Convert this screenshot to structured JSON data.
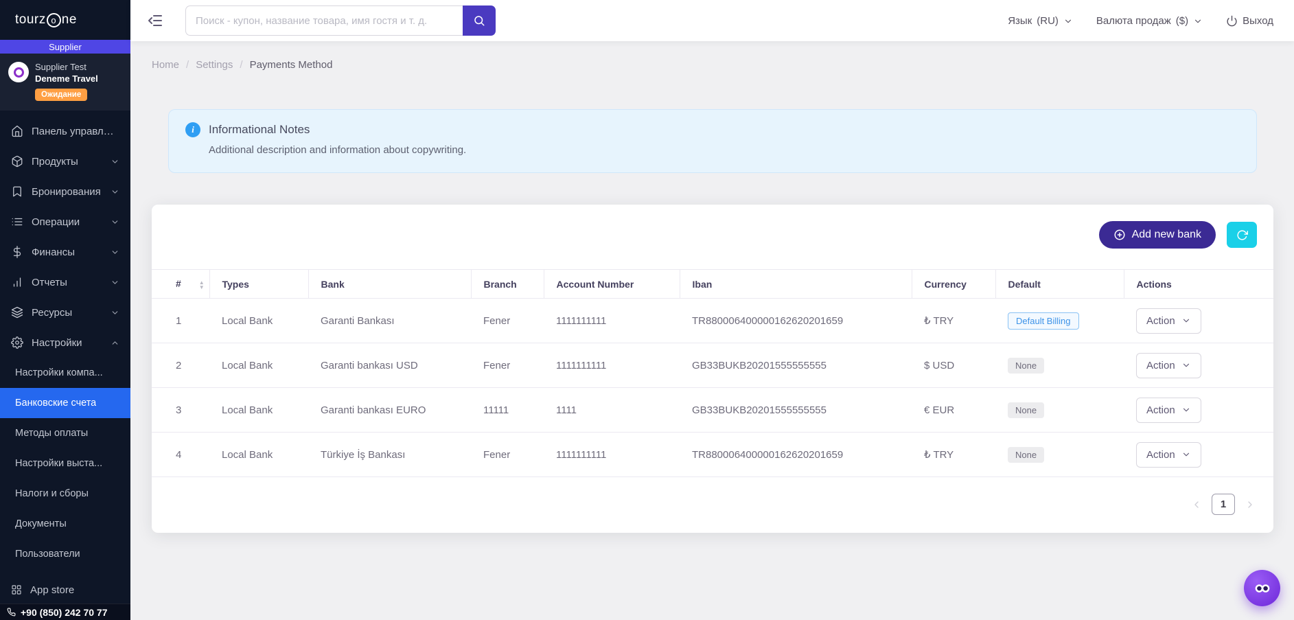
{
  "colors": {
    "page_bg": "#f0f0f2",
    "sidebar_bg": "#0e1627",
    "role_bar": "#4f46e5",
    "active_item": "#2568ef",
    "primary_button": "#3b2a94",
    "search_button": "#4a3ac0",
    "refresh_button": "#1ad0e8",
    "warning_badge": "#ff9f43",
    "info_bg": "#e7f4fd",
    "info_icon": "#2f9ef3",
    "billing_badge_text": "#3d93e8"
  },
  "sidebar": {
    "logo": {
      "pre": "tourz",
      "o": "o",
      "post": "ne"
    },
    "role_label": "Supplier",
    "profile": {
      "name": "Supplier Test",
      "company": "Deneme Travel",
      "status_badge": "Ожидание"
    },
    "items": [
      {
        "id": "dashboard",
        "label": "Панель управлен...",
        "icon": "home",
        "expandable": false
      },
      {
        "id": "products",
        "label": "Продукты",
        "icon": "box",
        "expandable": true
      },
      {
        "id": "bookings",
        "label": "Бронирования",
        "icon": "bookmark",
        "expandable": true
      },
      {
        "id": "operations",
        "label": "Операции",
        "icon": "list",
        "expandable": true
      },
      {
        "id": "finance",
        "label": "Финансы",
        "icon": "dollar",
        "expandable": true
      },
      {
        "id": "reports",
        "label": "Отчеты",
        "icon": "bar-chart",
        "expandable": true
      },
      {
        "id": "resources",
        "label": "Ресурсы",
        "icon": "layers",
        "expandable": true
      },
      {
        "id": "settings",
        "label": "Настройки",
        "icon": "gear",
        "expandable": true,
        "expanded": true
      }
    ],
    "settings_subitems": [
      {
        "id": "company-settings",
        "label": "Настройки компа...",
        "active": false
      },
      {
        "id": "bank-accounts",
        "label": "Банковские счета",
        "active": true
      },
      {
        "id": "payment-methods",
        "label": "Методы оплаты",
        "active": false
      },
      {
        "id": "invoice-settings",
        "label": "Настройки выста...",
        "active": false
      },
      {
        "id": "taxes-fees",
        "label": "Налоги и сборы",
        "active": false
      },
      {
        "id": "documents",
        "label": "Документы",
        "active": false
      },
      {
        "id": "users",
        "label": "Пользователи",
        "active": false
      }
    ],
    "app_store_label": "App store",
    "phone": "+90 (850) 242 70 77"
  },
  "header": {
    "search_placeholder": "Поиск - купон, название товара, имя гостя и т. д.",
    "language_label": "Язык",
    "language_value": "(RU)",
    "currency_label": "Валюта продаж",
    "currency_value": "($)",
    "logout_label": "Выход"
  },
  "breadcrumb": {
    "separator": "/",
    "items": [
      "Home",
      "Settings",
      "Payments Method"
    ]
  },
  "info_card": {
    "icon_glyph": "i",
    "title": "Informational Notes",
    "description": "Additional description and information about copywriting."
  },
  "table_card": {
    "add_button_label": "Add new bank",
    "action_label": "Action",
    "columns": [
      "#",
      "Types",
      "Bank",
      "Branch",
      "Account Number",
      "Iban",
      "Currency",
      "Default",
      "Actions"
    ],
    "rows": [
      {
        "num": "1",
        "type": "Local Bank",
        "bank": "Garanti Bankası",
        "branch": "Fener",
        "account": "1111111111",
        "iban": "TR880006400000162620201659",
        "currency": "₺ TRY",
        "default": "Default Billing",
        "default_style": "billing"
      },
      {
        "num": "2",
        "type": "Local Bank",
        "bank": "Garanti bankası USD",
        "branch": "Fener",
        "account": "1111111111",
        "iban": "GB33BUKB20201555555555",
        "currency": "$ USD",
        "default": "None",
        "default_style": "none"
      },
      {
        "num": "3",
        "type": "Local Bank",
        "bank": "Garanti bankası EURO",
        "branch": "11111",
        "account": "1111",
        "iban": "GB33BUKB20201555555555",
        "currency": "€ EUR",
        "default": "None",
        "default_style": "none"
      },
      {
        "num": "4",
        "type": "Local Bank",
        "bank": "Türkiye İş Bankası",
        "branch": "Fener",
        "account": "1111111111",
        "iban": "TR880006400000162620201659",
        "currency": "₺ TRY",
        "default": "None",
        "default_style": "none"
      }
    ],
    "pagination": {
      "current_page": "1"
    }
  }
}
